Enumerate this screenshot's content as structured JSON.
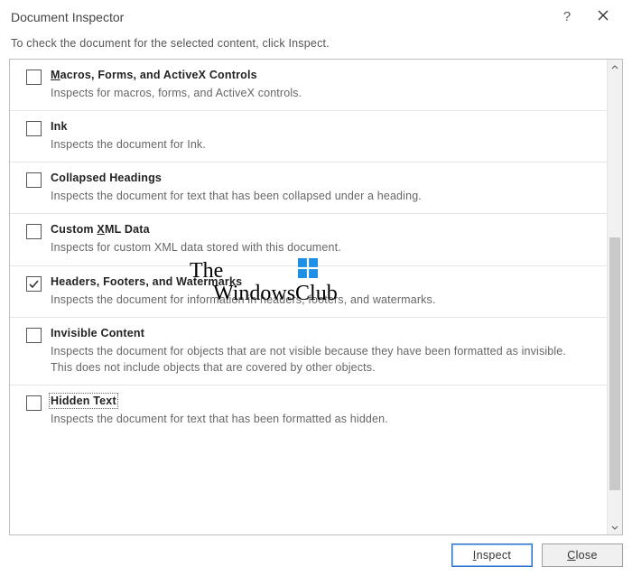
{
  "title": "Document Inspector",
  "subtitle": "To check the document for the selected content, click Inspect.",
  "items": [
    {
      "title_prefix": "M",
      "title_rest": "acros, Forms, and ActiveX Controls",
      "desc": "Inspects for macros, forms, and ActiveX controls.",
      "checked": false
    },
    {
      "title_prefix": "",
      "title_rest": "Ink",
      "desc": "Inspects the document for Ink.",
      "checked": false
    },
    {
      "title_prefix": "",
      "title_rest": "Collapsed Headings",
      "desc": "Inspects the document for text that has been collapsed under a heading.",
      "checked": false
    },
    {
      "title_preplain": "Custom ",
      "title_prefix": "X",
      "title_rest": "ML Data",
      "desc": "Inspects for custom XML data stored with this document.",
      "checked": false
    },
    {
      "title_prefix": "",
      "title_rest": "Headers, Footers, and Watermarks",
      "desc": "Inspects the document for information in headers, footers, and watermarks.",
      "checked": true
    },
    {
      "title_prefix": "",
      "title_rest": "Invisible Content",
      "desc": "Inspects the document for objects that are not visible because they have been formatted as invisible. This does not include objects that are covered by other objects.",
      "checked": false
    },
    {
      "title_prefix": "",
      "title_rest": "Hidden Text",
      "title_focus": true,
      "desc": "Inspects the document for text that has been formatted as hidden.",
      "checked": false
    }
  ],
  "buttons": {
    "inspect_prefix": "I",
    "inspect_rest": "nspect",
    "close_prefix": "C",
    "close_rest": "lose"
  },
  "watermark": {
    "line1": "The",
    "line2": "WindowsClub"
  }
}
